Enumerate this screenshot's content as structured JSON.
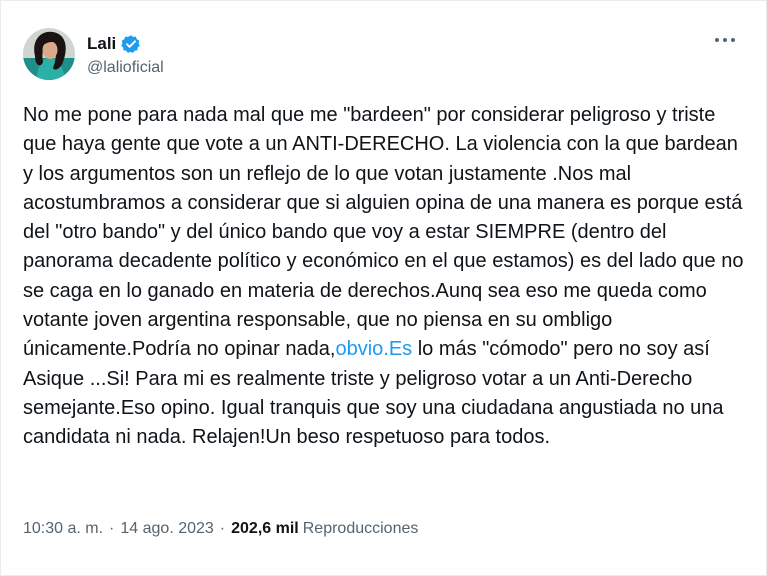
{
  "author": {
    "name": "Lali",
    "handle": "@lalioficial",
    "verified": true,
    "avatar_icon": "profile-photo"
  },
  "tweet": {
    "text_part1": "No me pone para nada mal que me \"bardeen\" por considerar peligroso y triste que haya gente que vote a un ANTI-DERECHO. La violencia con la que bardean y los argumentos son un reflejo de lo que votan justamente .Nos mal acostumbramos a considerar que si alguien opina de una manera es porque está del \"otro bando\" y del único bando que voy a estar SIEMPRE (dentro del panorama decadente político y económico en el que estamos) es del lado que no se caga en lo ganado en materia de derechos.Aunq sea eso me queda como votante joven argentina responsable, que no piensa en su ombligo únicamente.Podría no opinar nada,",
    "link_text": "obvio.Es",
    "text_part2": " lo más \"cómodo\" pero no soy así Asique ...Si! Para mi es realmente triste y peligroso votar a un Anti-Derecho semejante.Eso opino. Igual tranquis que soy una ciudadana angustiada no una candidata ni nada. Relajen!Un beso respetuoso para todos."
  },
  "meta": {
    "time": "10:30 a. m.",
    "separator": "·",
    "date": "14 ago. 2023",
    "views_count": "202,6 mil",
    "views_label": "Reproducciones"
  },
  "colors": {
    "text": "#0f1419",
    "secondary": "#536471",
    "link": "#1d9bf0",
    "verified": "#1d9bf0"
  },
  "icons": {
    "more": "more-horizontal-icon",
    "verified": "verified-badge-icon"
  }
}
